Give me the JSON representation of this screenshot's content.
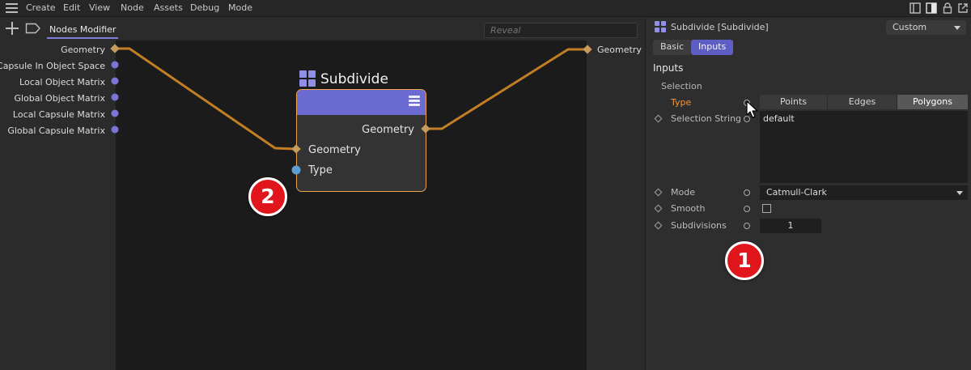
{
  "menubar": {
    "items": [
      "Create",
      "Edit",
      "View",
      "Node",
      "Assets",
      "Debug",
      "Mode"
    ]
  },
  "node_editor": {
    "tab_label": "Nodes Modifier",
    "search_placeholder": "Reveal",
    "input_ports": [
      "Geometry",
      "Capsule In Object Space",
      "Local Object Matrix",
      "Global Object Matrix",
      "Local Capsule Matrix",
      "Global Capsule Matrix"
    ],
    "output_port": "Geometry",
    "node": {
      "title": "Subdivide",
      "output_port": "Geometry",
      "input_ports": [
        "Geometry",
        "Type"
      ]
    }
  },
  "badges": {
    "one": "1",
    "two": "2"
  },
  "attributes": {
    "title": "Subdivide [Subdivide]",
    "preset": "Custom",
    "tabs": {
      "basic": "Basic",
      "inputs": "Inputs"
    },
    "section": "Inputs",
    "group": "Selection",
    "type": {
      "label": "Type",
      "options": [
        "Points",
        "Edges",
        "Polygons"
      ],
      "selected": "Polygons"
    },
    "selection_string": {
      "label": "Selection String",
      "value": "default"
    },
    "mode": {
      "label": "Mode",
      "value": "Catmull-Clark"
    },
    "smooth": {
      "label": "Smooth",
      "checked": false
    },
    "subdivisions": {
      "label": "Subdivisions",
      "value": "1"
    }
  },
  "colors": {
    "wire": "#c17e24",
    "node_header": "#6b6bd1",
    "node_border": "#f0a24a",
    "accent_tab": "#5d5dc4",
    "highlight_label": "#f2983e",
    "badge_red": "#e0161c"
  }
}
